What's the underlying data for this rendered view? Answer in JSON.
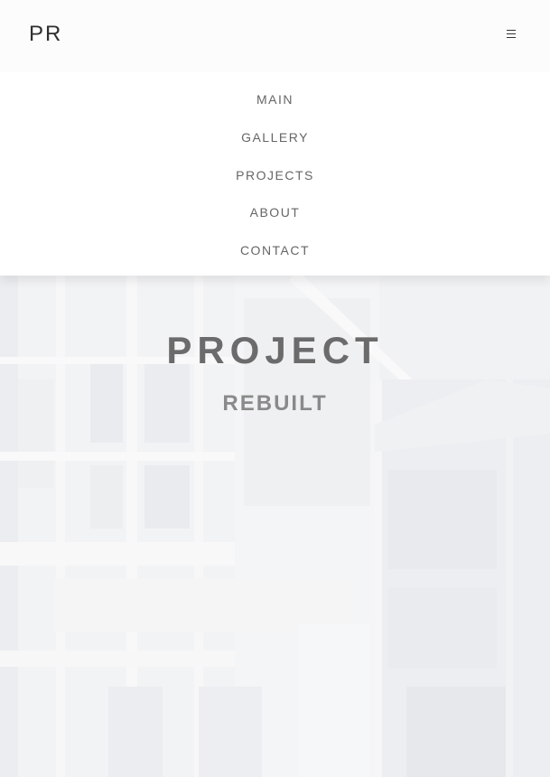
{
  "header": {
    "brand": "PR",
    "menu_icon": "hamburger-icon"
  },
  "nav": {
    "items": [
      {
        "label": "MAIN"
      },
      {
        "label": "GALLERY"
      },
      {
        "label": "PROJECTS"
      },
      {
        "label": "ABOUT"
      },
      {
        "label": "CONTACT"
      }
    ]
  },
  "hero": {
    "title": "PROJECT",
    "subtitle": "REBUILT",
    "background": "building-facade-image"
  },
  "colors": {
    "header_bg": "#fcfcfc",
    "nav_bg": "#ffffff",
    "nav_text": "#666666",
    "title_text": "#6b6b6b",
    "subtitle_text": "#8a8a8a"
  }
}
